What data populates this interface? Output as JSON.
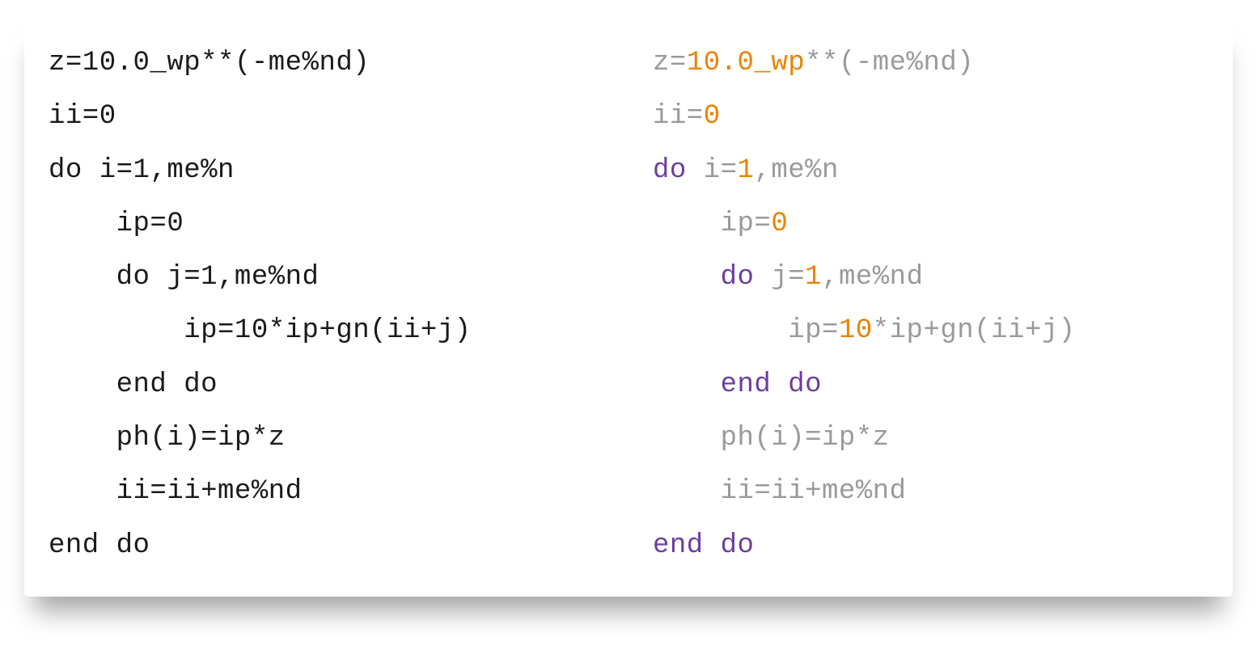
{
  "colors": {
    "plain": "#1a1a1a",
    "dim": "#9a9a9a",
    "keyword": "#6b3fa0",
    "number": "#e98300"
  },
  "left": {
    "l1": "z=10.0_wp**(-me%nd)",
    "l2": "ii=0",
    "l3": "do i=1,me%n",
    "l4": "    ip=0",
    "l5": "    do j=1,me%nd",
    "l6": "        ip=10*ip+gn(ii+j)",
    "l7": "    end do",
    "l8": "    ph(i)=ip*z",
    "l9": "    ii=ii+me%nd",
    "l10": "end do"
  },
  "right": {
    "l1a": "z=",
    "l1b": "10.0_wp",
    "l1c": "**(-me%nd)",
    "l2a": "ii=",
    "l2b": "0",
    "l3a": "do",
    "l3b": " i=",
    "l3c": "1",
    "l3d": ",me%n",
    "l4a": "    ip=",
    "l4b": "0",
    "l5a": "    ",
    "l5b": "do",
    "l5c": " j=",
    "l5d": "1",
    "l5e": ",me%nd",
    "l6a": "        ip=",
    "l6b": "10",
    "l6c": "*ip+gn(ii+j)",
    "l7a": "    ",
    "l7b": "end do",
    "l8": "    ph(i)=ip*z",
    "l9": "    ii=ii+me%nd",
    "l10": "end do"
  }
}
